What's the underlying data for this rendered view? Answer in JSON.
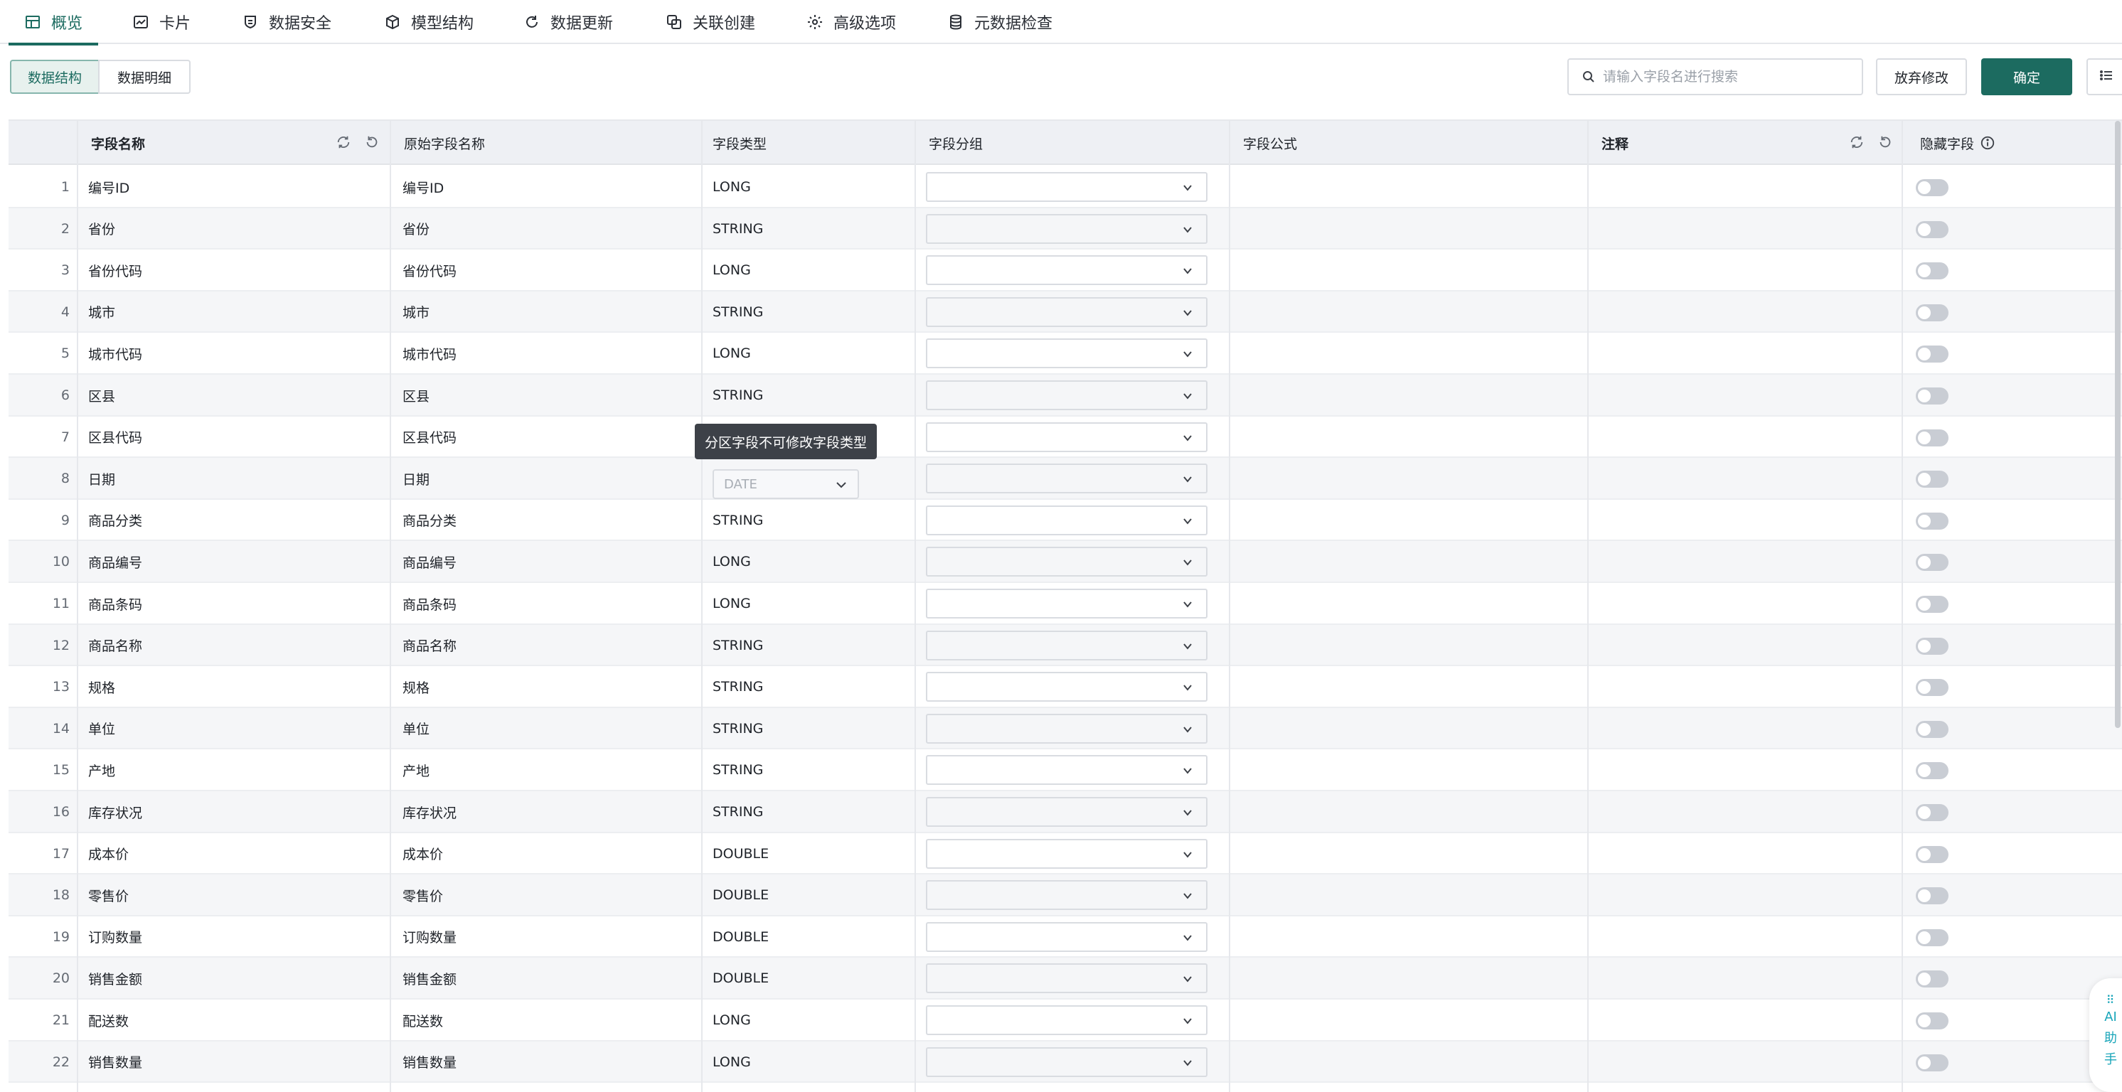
{
  "tabs": [
    {
      "label": "概览",
      "icon": "table-grid-icon",
      "active": true
    },
    {
      "label": "卡片",
      "icon": "card-chart-icon",
      "active": false
    },
    {
      "label": "数据安全",
      "icon": "shield-icon",
      "active": false
    },
    {
      "label": "模型结构",
      "icon": "cube-icon",
      "active": false
    },
    {
      "label": "数据更新",
      "icon": "refresh-icon",
      "active": false
    },
    {
      "label": "关联创建",
      "icon": "link-copy-icon",
      "active": false
    },
    {
      "label": "高级选项",
      "icon": "gear-icon",
      "active": false
    },
    {
      "label": "元数据检查",
      "icon": "database-icon",
      "active": false
    }
  ],
  "toolbar": {
    "view_structure": "数据结构",
    "view_detail": "数据明细",
    "search_placeholder": "请输入字段名进行搜索",
    "discard_label": "放弃修改",
    "confirm_label": "确定"
  },
  "columns": {
    "field_name": "字段名称",
    "original_name": "原始字段名称",
    "field_type": "字段类型",
    "field_group": "字段分组",
    "field_formula": "字段公式",
    "comment": "注释",
    "hidden_field": "隐藏字段"
  },
  "rows": [
    {
      "index": "1",
      "name": "编号ID",
      "original": "编号ID",
      "type": "LONG"
    },
    {
      "index": "2",
      "name": "省份",
      "original": "省份",
      "type": "STRING"
    },
    {
      "index": "3",
      "name": "省份代码",
      "original": "省份代码",
      "type": "LONG"
    },
    {
      "index": "4",
      "name": "城市",
      "original": "城市",
      "type": "STRING"
    },
    {
      "index": "5",
      "name": "城市代码",
      "original": "城市代码",
      "type": "LONG"
    },
    {
      "index": "6",
      "name": "区县",
      "original": "区县",
      "type": "STRING"
    },
    {
      "index": "7",
      "name": "区县代码",
      "original": "区县代码",
      "type": ""
    },
    {
      "index": "8",
      "name": "日期",
      "original": "日期",
      "type": ""
    },
    {
      "index": "9",
      "name": "商品分类",
      "original": "商品分类",
      "type": "STRING"
    },
    {
      "index": "10",
      "name": "商品编号",
      "original": "商品编号",
      "type": "LONG"
    },
    {
      "index": "11",
      "name": "商品条码",
      "original": "商品条码",
      "type": "LONG"
    },
    {
      "index": "12",
      "name": "商品名称",
      "original": "商品名称",
      "type": "STRING"
    },
    {
      "index": "13",
      "name": "规格",
      "original": "规格",
      "type": "STRING"
    },
    {
      "index": "14",
      "name": "单位",
      "original": "单位",
      "type": "STRING"
    },
    {
      "index": "15",
      "name": "产地",
      "original": "产地",
      "type": "STRING"
    },
    {
      "index": "16",
      "name": "库存状况",
      "original": "库存状况",
      "type": "STRING"
    },
    {
      "index": "17",
      "name": "成本价",
      "original": "成本价",
      "type": "DOUBLE"
    },
    {
      "index": "18",
      "name": "零售价",
      "original": "零售价",
      "type": "DOUBLE"
    },
    {
      "index": "19",
      "name": "订购数量",
      "original": "订购数量",
      "type": "DOUBLE"
    },
    {
      "index": "20",
      "name": "销售金额",
      "original": "销售金额",
      "type": "DOUBLE"
    },
    {
      "index": "21",
      "name": "配送数",
      "original": "配送数",
      "type": "LONG"
    },
    {
      "index": "22",
      "name": "销售数量",
      "original": "销售数量",
      "type": "LONG"
    }
  ],
  "date_select_value": "DATE",
  "tooltip": "分区字段不可修改字段类型",
  "ai_assistant": {
    "line1": "AI",
    "line2": "助",
    "line3": "手"
  },
  "colors": {
    "accent": "#1c6b60",
    "header_bg": "#eef0f4",
    "tooltip_bg": "#3d4148"
  }
}
